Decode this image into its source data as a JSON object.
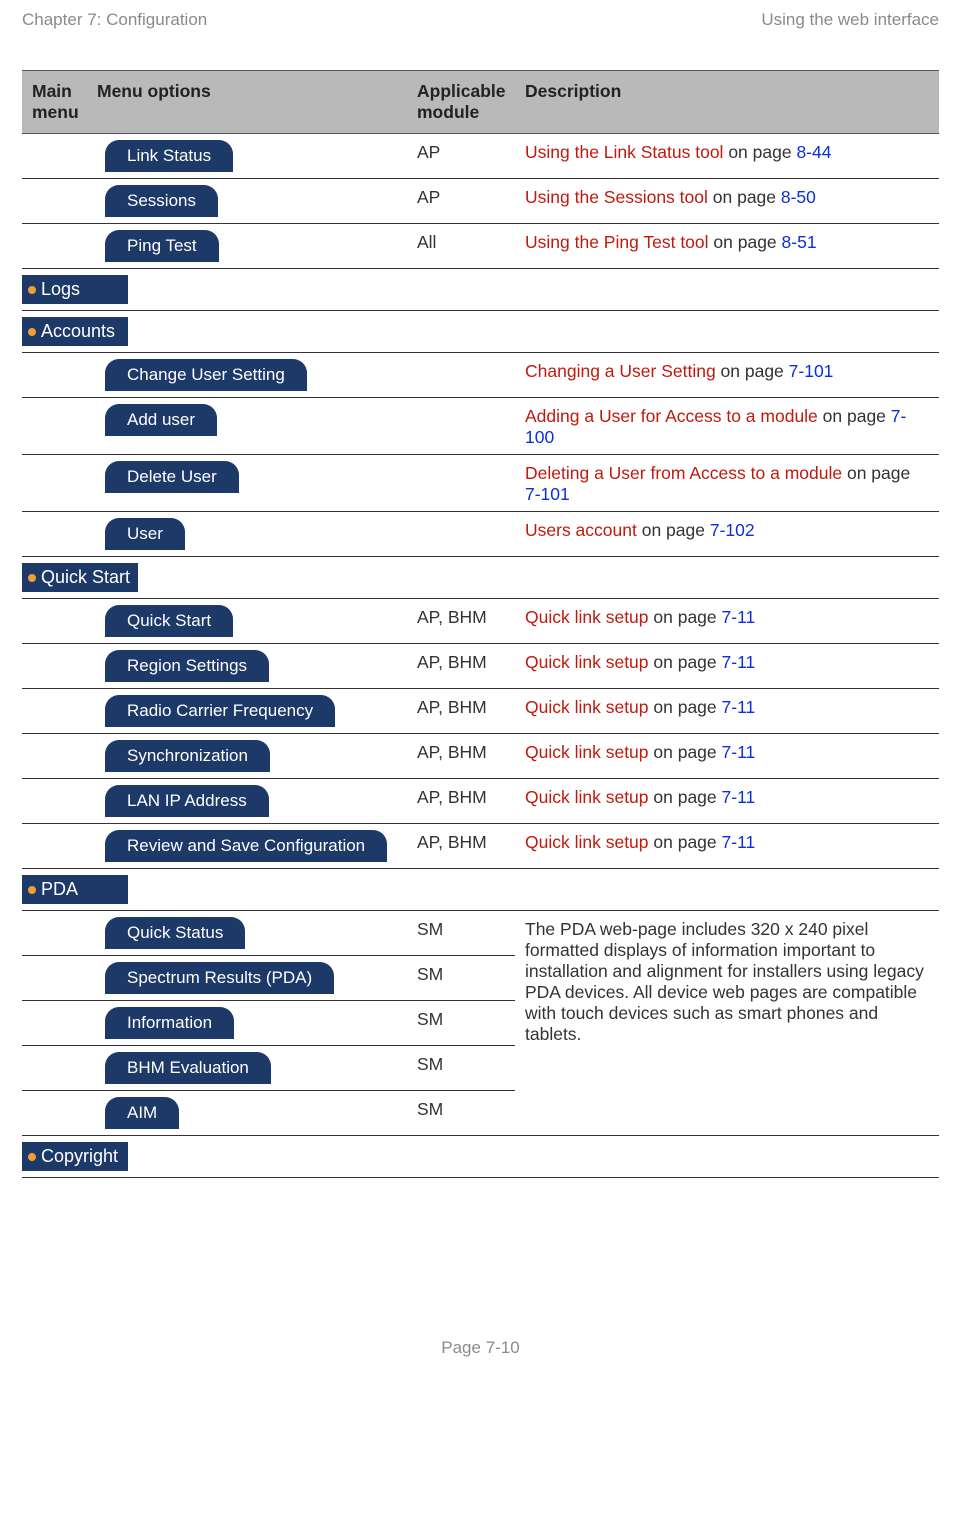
{
  "header": {
    "left": "Chapter 7:  Configuration",
    "right": "Using the web interface"
  },
  "table": {
    "headers": {
      "main": "Main menu",
      "menu": "Menu options",
      "module": "Applicable module",
      "desc": "Description"
    }
  },
  "rows": {
    "link_status": {
      "label": "Link Status",
      "module": "AP",
      "link": "Using the Link Status tool",
      "suffix": " on page ",
      "page": "8-44"
    },
    "sessions": {
      "label": "Sessions",
      "module": "AP",
      "link": "Using the Sessions tool",
      "suffix": " on page ",
      "page": "8-50"
    },
    "ping_test": {
      "label": "Ping Test",
      "module": "All",
      "link": "Using the Ping Test tool",
      "suffix": " on page ",
      "page": "8-51"
    },
    "change_user": {
      "label": "Change User Setting",
      "module": "",
      "link": "Changing a User Setting",
      "suffix": " on page ",
      "page": "7-101"
    },
    "add_user": {
      "label": "Add user",
      "module": "",
      "link": "Adding a User for Access to a module",
      "suffix": " on page ",
      "page": "7-100"
    },
    "delete_user": {
      "label": "Delete User",
      "module": "",
      "link": "Deleting a User from Access to a module",
      "suffix": " on page ",
      "page": "7-101"
    },
    "user": {
      "label": "User",
      "module": "",
      "link": "Users account",
      "suffix": " on page ",
      "page": "7-102"
    },
    "qs_quick": {
      "label": "Quick Start",
      "module": "AP, BHM",
      "link": "Quick link setup",
      "suffix": " on page ",
      "page": "7-11"
    },
    "qs_region": {
      "label": "Region Settings",
      "module": "AP, BHM",
      "link": "Quick link setup",
      "suffix": " on page ",
      "page": "7-11"
    },
    "qs_radio": {
      "label": "Radio Carrier Frequency",
      "module": "AP, BHM",
      "link": "Quick link setup",
      "suffix": " on page ",
      "page": "7-11"
    },
    "qs_sync": {
      "label": "Synchronization",
      "module": "AP, BHM",
      "link": "Quick link setup",
      "suffix": " on page ",
      "page": "7-11"
    },
    "qs_lan": {
      "label": "LAN IP Address",
      "module": "AP, BHM",
      "link": "Quick link setup",
      "suffix": " on page ",
      "page": "7-11"
    },
    "qs_review": {
      "label": "Review and Save Configuration",
      "module": "AP, BHM",
      "link": "Quick link setup",
      "suffix": " on page ",
      "page": "7-11"
    },
    "pda_quick": {
      "label": "Quick Status",
      "module": "SM"
    },
    "pda_spectrum": {
      "label": "Spectrum Results (PDA)",
      "module": "SM"
    },
    "pda_info": {
      "label": "Information",
      "module": "SM"
    },
    "pda_bhm": {
      "label": "BHM Evaluation",
      "module": "SM"
    },
    "pda_aim": {
      "label": "AIM",
      "module": "SM"
    }
  },
  "sections": {
    "logs": "Logs",
    "accounts": "Accounts",
    "quick_start": "Quick Start",
    "pda": "PDA",
    "copyright": "Copyright"
  },
  "pda_description": "The PDA web-page includes 320 x 240 pixel formatted displays of information important to installation and alignment for installers using legacy PDA devices. All device web pages are compatible with touch devices such as smart phones and tablets.",
  "footer": "Page 7-10"
}
